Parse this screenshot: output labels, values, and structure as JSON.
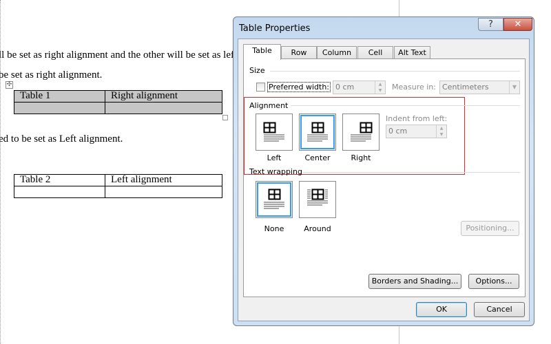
{
  "document": {
    "lines": [
      "ll be set as right alignment and the other will be set as left",
      "be set as right alignment.",
      "ed to be set as Left alignment."
    ],
    "table1": {
      "cells": [
        [
          "Table 1",
          "Right alignment"
        ],
        [
          "",
          ""
        ]
      ]
    },
    "table2": {
      "cells": [
        [
          "Table 2",
          "Left alignment"
        ],
        [
          "",
          ""
        ]
      ]
    }
  },
  "dialog": {
    "title": "Table Properties",
    "help": "?",
    "close": "✕",
    "tabs": [
      {
        "label": "Table",
        "selected": true
      },
      {
        "label": "Row"
      },
      {
        "label": "Column"
      },
      {
        "label": "Cell"
      },
      {
        "label": "Alt Text"
      }
    ],
    "size": {
      "label": "Size",
      "preferred_width_label": "Preferred width:",
      "preferred_width_checked": false,
      "preferred_width_value": "0 cm",
      "measure_in_label": "Measure in:",
      "measure_in_value": "Centimeters"
    },
    "alignment": {
      "label": "Alignment",
      "options": [
        "Left",
        "Center",
        "Right"
      ],
      "selected": "Center",
      "indent_label": "Indent from left:",
      "indent_value": "0 cm"
    },
    "text_wrapping": {
      "label": "Text wrapping",
      "options": [
        "None",
        "Around"
      ],
      "selected": "None"
    },
    "buttons": {
      "positioning": "Positioning...",
      "borders": "Borders and Shading...",
      "options": "Options...",
      "ok": "OK",
      "cancel": "Cancel"
    },
    "highlight_color": "#e8262c",
    "selection_color": "#3399ff"
  }
}
